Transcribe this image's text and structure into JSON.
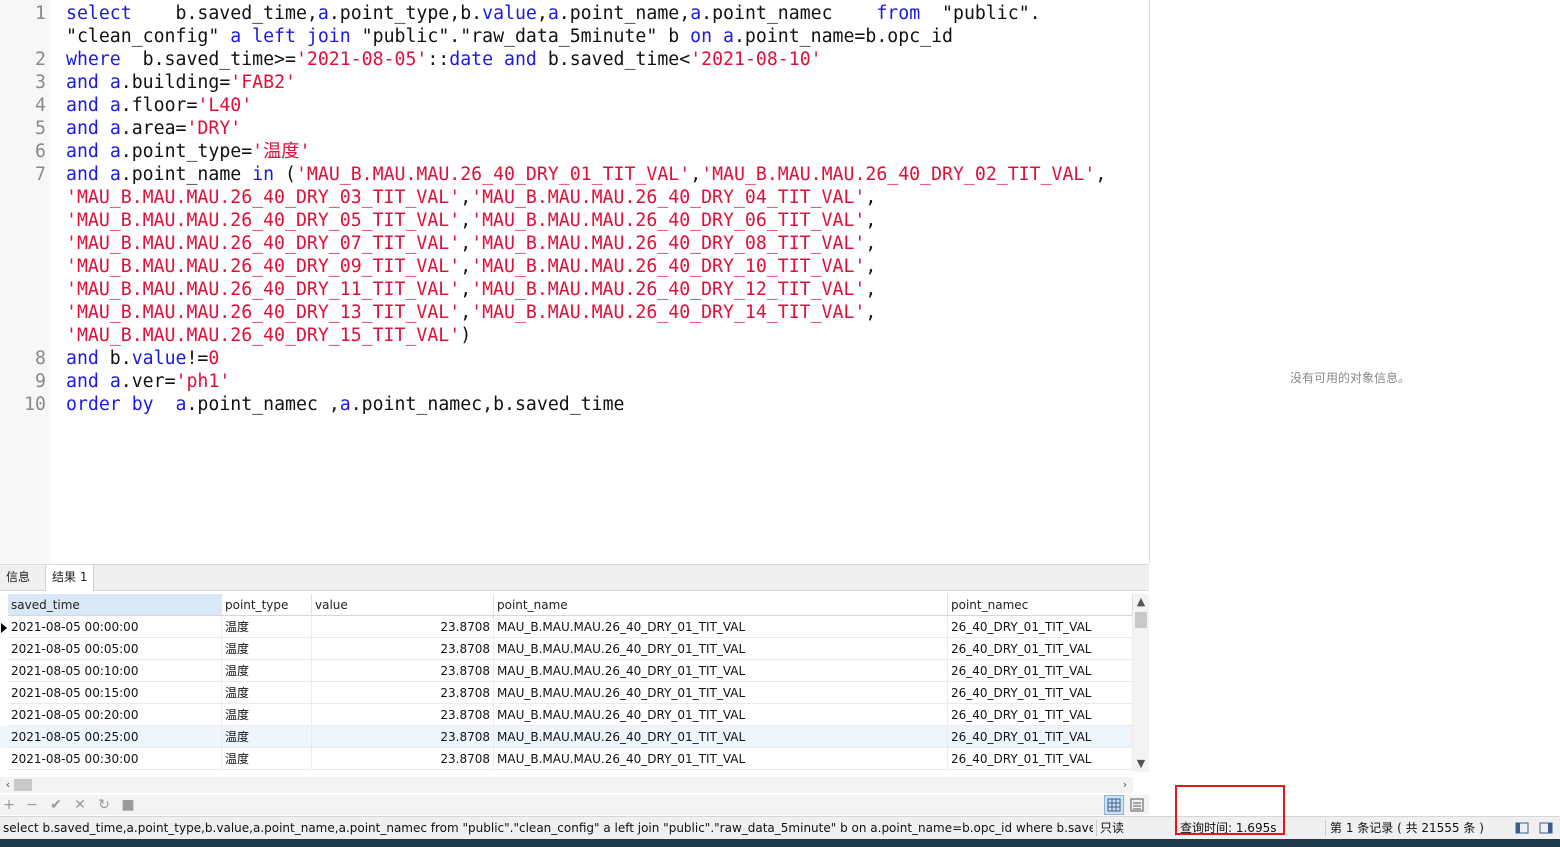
{
  "editor": {
    "lines": [
      {
        "num": "1",
        "tokens": [
          {
            "t": "select",
            "c": "kw"
          },
          {
            "t": "    b.saved_time,",
            "c": "op"
          },
          {
            "t": "a",
            "c": "al"
          },
          {
            "t": ".point_type,b.",
            "c": "op"
          },
          {
            "t": "value",
            "c": "kw"
          },
          {
            "t": ",",
            "c": "op"
          },
          {
            "t": "a",
            "c": "al"
          },
          {
            "t": ".point_name,",
            "c": "op"
          },
          {
            "t": "a",
            "c": "al"
          },
          {
            "t": ".point_namec    ",
            "c": "op"
          },
          {
            "t": "from",
            "c": "kw"
          },
          {
            "t": "  \"public\".",
            "c": "op"
          }
        ]
      },
      {
        "num": "",
        "tokens": [
          {
            "t": "\"clean_config\" ",
            "c": "op"
          },
          {
            "t": "a",
            "c": "al"
          },
          {
            "t": " ",
            "c": "op"
          },
          {
            "t": "left join",
            "c": "kw"
          },
          {
            "t": " \"public\".\"raw_data_5minute\" b ",
            "c": "op"
          },
          {
            "t": "on",
            "c": "kw"
          },
          {
            "t": " ",
            "c": "op"
          },
          {
            "t": "a",
            "c": "al"
          },
          {
            "t": ".point_name=b.opc_id",
            "c": "op"
          }
        ]
      },
      {
        "num": "2",
        "tokens": [
          {
            "t": "where",
            "c": "kw"
          },
          {
            "t": "  b.saved_time>=",
            "c": "op"
          },
          {
            "t": "'2021-08-05'",
            "c": "str"
          },
          {
            "t": "::",
            "c": "op"
          },
          {
            "t": "date",
            "c": "kw"
          },
          {
            "t": " ",
            "c": "op"
          },
          {
            "t": "and",
            "c": "kw"
          },
          {
            "t": " b.saved_time<",
            "c": "op"
          },
          {
            "t": "'2021-08-10'",
            "c": "str"
          }
        ]
      },
      {
        "num": "3",
        "tokens": [
          {
            "t": "and",
            "c": "kw"
          },
          {
            "t": " ",
            "c": "op"
          },
          {
            "t": "a",
            "c": "al"
          },
          {
            "t": ".building=",
            "c": "op"
          },
          {
            "t": "'FAB2'",
            "c": "str"
          }
        ]
      },
      {
        "num": "4",
        "tokens": [
          {
            "t": "and",
            "c": "kw"
          },
          {
            "t": " ",
            "c": "op"
          },
          {
            "t": "a",
            "c": "al"
          },
          {
            "t": ".floor=",
            "c": "op"
          },
          {
            "t": "'L40'",
            "c": "str"
          }
        ]
      },
      {
        "num": "5",
        "tokens": [
          {
            "t": "and",
            "c": "kw"
          },
          {
            "t": " ",
            "c": "op"
          },
          {
            "t": "a",
            "c": "al"
          },
          {
            "t": ".area=",
            "c": "op"
          },
          {
            "t": "'DRY'",
            "c": "str"
          }
        ]
      },
      {
        "num": "6",
        "tokens": [
          {
            "t": "and",
            "c": "kw"
          },
          {
            "t": " ",
            "c": "op"
          },
          {
            "t": "a",
            "c": "al"
          },
          {
            "t": ".point_type=",
            "c": "op"
          },
          {
            "t": "'温度'",
            "c": "str"
          }
        ]
      },
      {
        "num": "7",
        "tokens": [
          {
            "t": "and",
            "c": "kw"
          },
          {
            "t": " ",
            "c": "op"
          },
          {
            "t": "a",
            "c": "al"
          },
          {
            "t": ".point_name ",
            "c": "op"
          },
          {
            "t": "in",
            "c": "kw"
          },
          {
            "t": " (",
            "c": "op"
          },
          {
            "t": "'MAU_B.MAU.MAU.26_40_DRY_01_TIT_VAL'",
            "c": "str"
          },
          {
            "t": ",",
            "c": "op"
          },
          {
            "t": "'MAU_B.MAU.MAU.26_40_DRY_02_TIT_VAL'",
            "c": "str"
          },
          {
            "t": ",",
            "c": "op"
          }
        ]
      },
      {
        "num": "",
        "tokens": [
          {
            "t": "'MAU_B.MAU.MAU.26_40_DRY_03_TIT_VAL'",
            "c": "str"
          },
          {
            "t": ",",
            "c": "op"
          },
          {
            "t": "'MAU_B.MAU.MAU.26_40_DRY_04_TIT_VAL'",
            "c": "str"
          },
          {
            "t": ",",
            "c": "op"
          }
        ]
      },
      {
        "num": "",
        "tokens": [
          {
            "t": "'MAU_B.MAU.MAU.26_40_DRY_05_TIT_VAL'",
            "c": "str"
          },
          {
            "t": ",",
            "c": "op"
          },
          {
            "t": "'MAU_B.MAU.MAU.26_40_DRY_06_TIT_VAL'",
            "c": "str"
          },
          {
            "t": ",",
            "c": "op"
          }
        ]
      },
      {
        "num": "",
        "tokens": [
          {
            "t": "'MAU_B.MAU.MAU.26_40_DRY_07_TIT_VAL'",
            "c": "str"
          },
          {
            "t": ",",
            "c": "op"
          },
          {
            "t": "'MAU_B.MAU.MAU.26_40_DRY_08_TIT_VAL'",
            "c": "str"
          },
          {
            "t": ",",
            "c": "op"
          }
        ]
      },
      {
        "num": "",
        "tokens": [
          {
            "t": "'MAU_B.MAU.MAU.26_40_DRY_09_TIT_VAL'",
            "c": "str"
          },
          {
            "t": ",",
            "c": "op"
          },
          {
            "t": "'MAU_B.MAU.MAU.26_40_DRY_10_TIT_VAL'",
            "c": "str"
          },
          {
            "t": ",",
            "c": "op"
          }
        ]
      },
      {
        "num": "",
        "tokens": [
          {
            "t": "'MAU_B.MAU.MAU.26_40_DRY_11_TIT_VAL'",
            "c": "str"
          },
          {
            "t": ",",
            "c": "op"
          },
          {
            "t": "'MAU_B.MAU.MAU.26_40_DRY_12_TIT_VAL'",
            "c": "str"
          },
          {
            "t": ",",
            "c": "op"
          }
        ]
      },
      {
        "num": "",
        "tokens": [
          {
            "t": "'MAU_B.MAU.MAU.26_40_DRY_13_TIT_VAL'",
            "c": "str"
          },
          {
            "t": ",",
            "c": "op"
          },
          {
            "t": "'MAU_B.MAU.MAU.26_40_DRY_14_TIT_VAL'",
            "c": "str"
          },
          {
            "t": ",",
            "c": "op"
          }
        ]
      },
      {
        "num": "",
        "tokens": [
          {
            "t": "'MAU_B.MAU.MAU.26_40_DRY_15_TIT_VAL'",
            "c": "str"
          },
          {
            "t": ")",
            "c": "op"
          }
        ]
      },
      {
        "num": "8",
        "tokens": [
          {
            "t": "and",
            "c": "kw"
          },
          {
            "t": " b.",
            "c": "op"
          },
          {
            "t": "value",
            "c": "kw"
          },
          {
            "t": "!=",
            "c": "op"
          },
          {
            "t": "0",
            "c": "num"
          }
        ]
      },
      {
        "num": "9",
        "tokens": [
          {
            "t": "and",
            "c": "kw"
          },
          {
            "t": " ",
            "c": "op"
          },
          {
            "t": "a",
            "c": "al"
          },
          {
            "t": ".ver=",
            "c": "op"
          },
          {
            "t": "'ph1'",
            "c": "str"
          }
        ]
      },
      {
        "num": "10",
        "tokens": [
          {
            "t": "order by",
            "c": "kw"
          },
          {
            "t": "  ",
            "c": "op"
          },
          {
            "t": "a",
            "c": "al"
          },
          {
            "t": ".point_namec ,",
            "c": "op"
          },
          {
            "t": "a",
            "c": "al"
          },
          {
            "t": ".point_namec,b.saved_time",
            "c": "op"
          }
        ]
      }
    ]
  },
  "info_panel": {
    "message": "没有可用的对象信息。"
  },
  "tabs": {
    "info": "信息",
    "result": "结果 1"
  },
  "grid": {
    "columns": [
      "saved_time",
      "point_type",
      "value",
      "point_name",
      "point_namec"
    ],
    "rows": [
      [
        "2021-08-05 00:00:00",
        "温度",
        "23.8708",
        "MAU_B.MAU.MAU.26_40_DRY_01_TIT_VAL",
        "26_40_DRY_01_TIT_VAL"
      ],
      [
        "2021-08-05 00:05:00",
        "温度",
        "23.8708",
        "MAU_B.MAU.MAU.26_40_DRY_01_TIT_VAL",
        "26_40_DRY_01_TIT_VAL"
      ],
      [
        "2021-08-05 00:10:00",
        "温度",
        "23.8708",
        "MAU_B.MAU.MAU.26_40_DRY_01_TIT_VAL",
        "26_40_DRY_01_TIT_VAL"
      ],
      [
        "2021-08-05 00:15:00",
        "温度",
        "23.8708",
        "MAU_B.MAU.MAU.26_40_DRY_01_TIT_VAL",
        "26_40_DRY_01_TIT_VAL"
      ],
      [
        "2021-08-05 00:20:00",
        "温度",
        "23.8708",
        "MAU_B.MAU.MAU.26_40_DRY_01_TIT_VAL",
        "26_40_DRY_01_TIT_VAL"
      ],
      [
        "2021-08-05 00:25:00",
        "温度",
        "23.8708",
        "MAU_B.MAU.MAU.26_40_DRY_01_TIT_VAL",
        "26_40_DRY_01_TIT_VAL"
      ],
      [
        "2021-08-05 00:30:00",
        "温度",
        "23.8708",
        "MAU_B.MAU.MAU.26_40_DRY_01_TIT_VAL",
        "26_40_DRY_01_TIT_VAL"
      ]
    ]
  },
  "toolbar": {
    "icons": [
      "plus-icon",
      "minus-icon",
      "check-icon",
      "cross-icon",
      "refresh-icon",
      "stop-icon"
    ],
    "glyphs": [
      "+",
      "−",
      "✔",
      "✕",
      "↻",
      "■"
    ]
  },
  "status": {
    "sql": "select   b.saved_time,a.point_type,b.value,a.point_name,a.point_namec   from  \"public\".\"clean_config\" a left join \"public\".\"raw_data_5minute\" b on a.point_name=b.opc_id where  b.saved_time",
    "readonly": "只读",
    "query_time": "查询时间: 1.695s",
    "record": "第 1 条记录 ( 共 21555 条 )"
  },
  "colors": {
    "keyword": "#1a1ae6",
    "string": "#e0103a",
    "highlight_box": "#e8141e"
  }
}
